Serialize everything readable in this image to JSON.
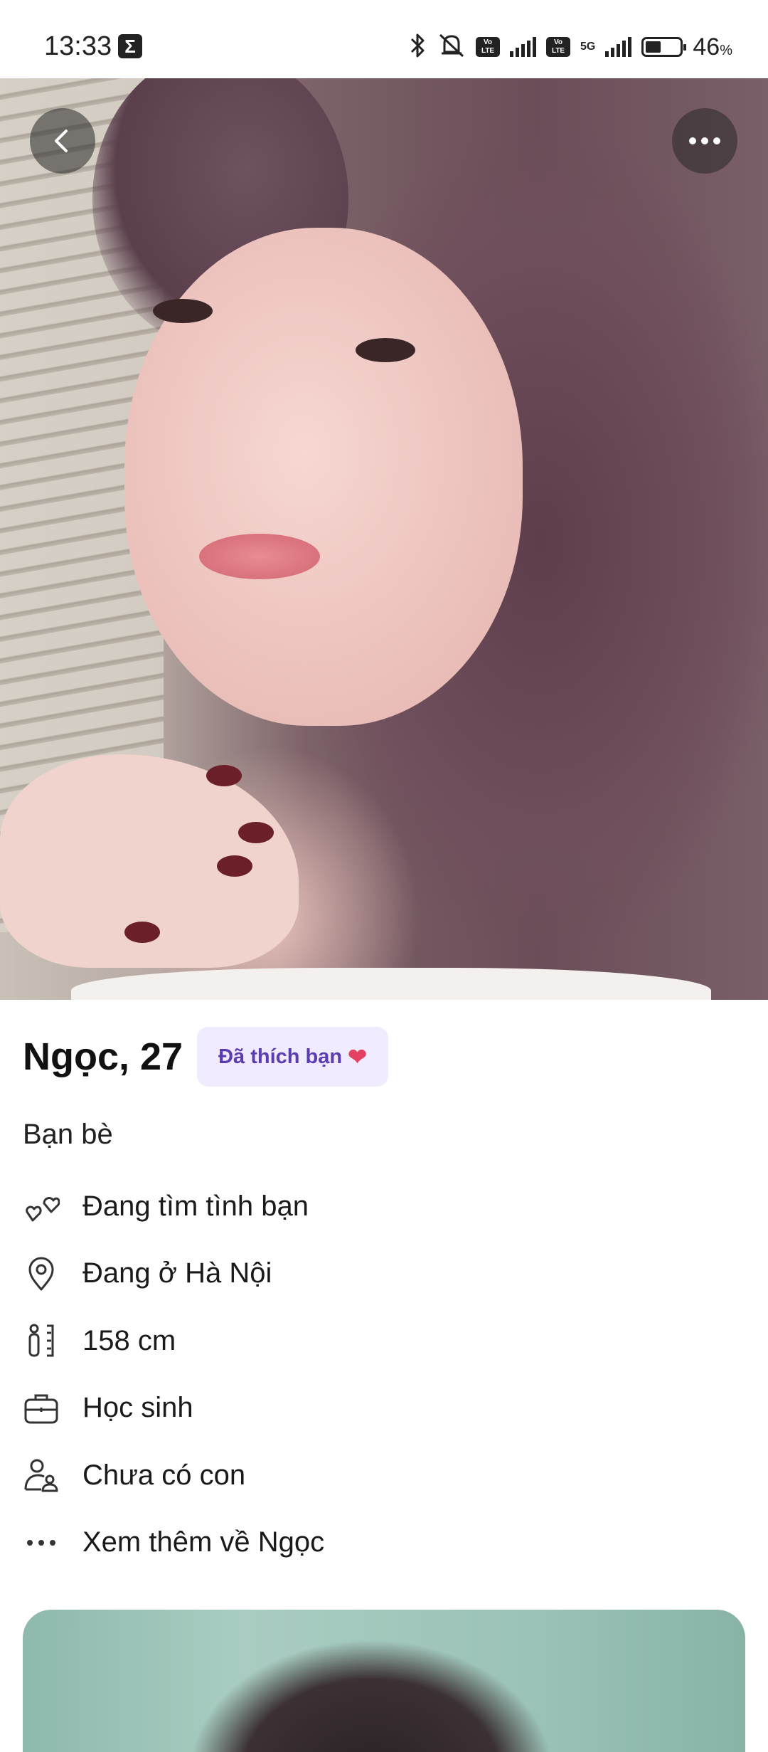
{
  "status_bar": {
    "time": "13:33",
    "battery_percent": "46",
    "battery_unit": "%",
    "battery_level": 0.46
  },
  "photo": {
    "back_icon": "chevron-left-icon",
    "more_icon": "more-horizontal-icon"
  },
  "profile": {
    "name_age": "Ngọc, 27",
    "liked_badge": "Đã thích bạn",
    "liked_icon": "double-heart-icon",
    "category": "Bạn bè",
    "details": [
      {
        "icon": "hearts-outline-icon",
        "label": "Đang tìm tình bạn"
      },
      {
        "icon": "location-pin-icon",
        "label": "Đang ở Hà Nội"
      },
      {
        "icon": "height-ruler-icon",
        "label": "158 cm"
      },
      {
        "icon": "briefcase-icon",
        "label": "Học sinh"
      },
      {
        "icon": "parent-child-icon",
        "label": "Chưa có con"
      },
      {
        "icon": "more-dots-icon",
        "label": "Xem thêm về Ngọc"
      }
    ]
  },
  "colors": {
    "badge_bg": "#f1ebff",
    "badge_text": "#5a3db0",
    "text": "#111111",
    "icon": "#333333"
  }
}
